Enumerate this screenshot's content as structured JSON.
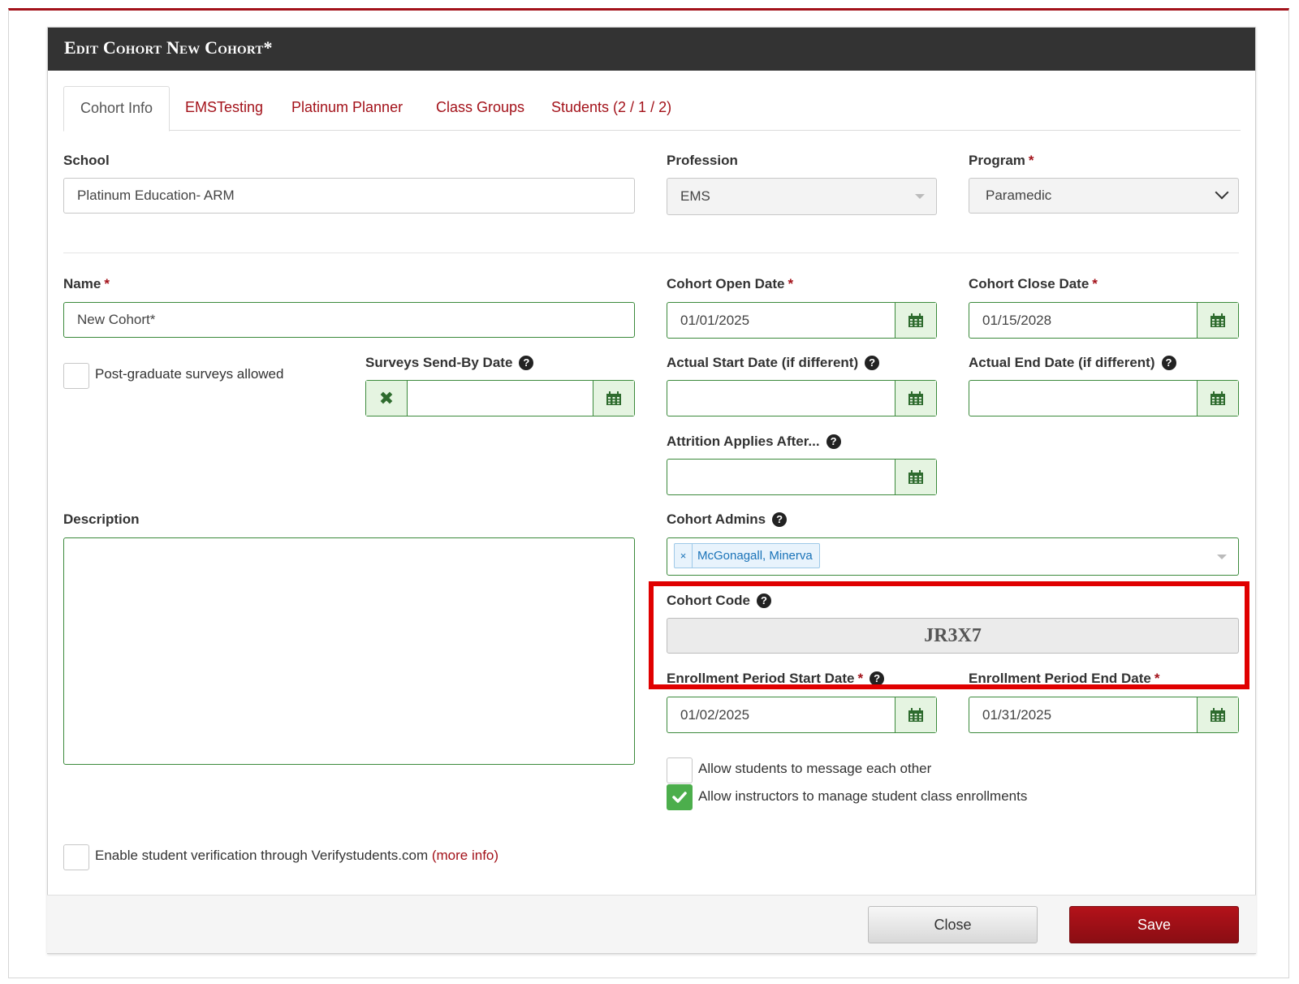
{
  "modal": {
    "title": "Edit Cohort New Cohort*"
  },
  "tabs": [
    {
      "label": "Cohort Info",
      "active": true
    },
    {
      "label": "EMSTesting"
    },
    {
      "label": "Platinum Planner"
    },
    {
      "label": "Class Groups"
    },
    {
      "label": "Students (2 / 1 / 2)"
    }
  ],
  "school": {
    "label": "School",
    "value": "Platinum Education- ARM"
  },
  "profession": {
    "label": "Profession",
    "value": "EMS"
  },
  "program": {
    "label": "Program",
    "value": "Paramedic"
  },
  "required_mark": "*",
  "name": {
    "label": "Name",
    "value": "New Cohort*"
  },
  "open_date": {
    "label": "Cohort Open Date",
    "value": "01/01/2025"
  },
  "close_date": {
    "label": "Cohort Close Date",
    "value": "01/15/2028"
  },
  "post_grad": {
    "label": "Post-graduate surveys allowed",
    "checked": false
  },
  "surveys_send_by": {
    "label": "Surveys Send-By Date",
    "value": ""
  },
  "actual_start": {
    "label": "Actual Start Date (if different)",
    "value": ""
  },
  "actual_end": {
    "label": "Actual End Date (if different)",
    "value": ""
  },
  "attrition": {
    "label": "Attrition Applies After...",
    "value": ""
  },
  "description": {
    "label": "Description",
    "value": ""
  },
  "cohort_admins": {
    "label": "Cohort Admins",
    "tags": [
      "McGonagall, Minerva"
    ]
  },
  "cohort_code": {
    "label": "Cohort Code",
    "value": "JR3X7"
  },
  "enroll_start": {
    "label": "Enrollment Period Start Date",
    "value": "01/02/2025"
  },
  "enroll_end": {
    "label": "Enrollment Period End Date",
    "value": "01/31/2025"
  },
  "allow_message": {
    "label": "Allow students to message each other",
    "checked": false
  },
  "allow_instructors": {
    "label": "Allow instructors to manage student class enrollments",
    "checked": true
  },
  "verify": {
    "label": "Enable student verification through Verifystudents.com",
    "link": "(more info)",
    "checked": false
  },
  "footer": {
    "close_label": "Close",
    "save_label": "Save"
  },
  "colors": {
    "accent": "#a3121a",
    "header_bg": "#333333",
    "field_green": "#3c8a3c",
    "check_green": "#4cae4c",
    "highlight": "#e00000"
  },
  "icons": {
    "calendar": "calendar-icon",
    "clear": "clear-x-icon",
    "help": "question-circle-icon"
  }
}
